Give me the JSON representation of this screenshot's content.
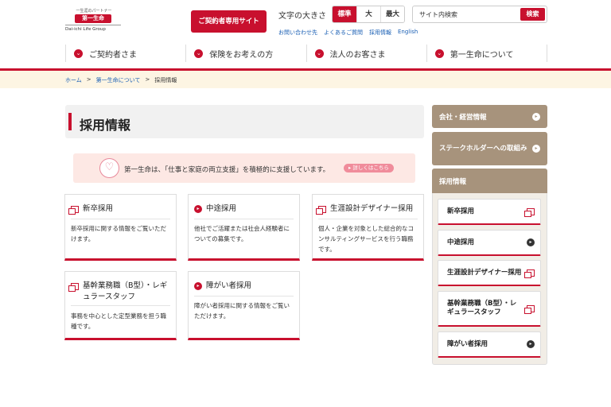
{
  "logo": {
    "tagline": "一生涯のパートナー",
    "mark": "第一生命",
    "group": "Dai-ichi Life Group"
  },
  "header": {
    "contract_button": "ご契約者専用サイト",
    "font_size_label": "文字の大きさ",
    "font_sizes": [
      "標準",
      "大",
      "最大"
    ],
    "search_placeholder": "サイト内検索",
    "search_button": "検索",
    "util_links": [
      "お問い合わせ先",
      "よくあるご質問",
      "採用情報",
      "English"
    ]
  },
  "nav": [
    "ご契約者さま",
    "保険をお考えの方",
    "法人のお客さま",
    "第一生命について"
  ],
  "breadcrumb": [
    "ホーム",
    "第一生命について",
    "採用情報"
  ],
  "page_title": "採用情報",
  "banner": {
    "text": "第一生命は、「仕事と家庭の両立支援」を積極的に支援しています。",
    "link": "▸ 詳しくはこちら"
  },
  "cards": [
    {
      "title": "新卒採用",
      "desc": "新卒採用に関する情報をご覧いただけます。",
      "icon": "external-link"
    },
    {
      "title": "中途採用",
      "desc": "他社でご活躍または社会人経験者についての募集です。",
      "icon": "arrow-circle"
    },
    {
      "title": "生涯設計デザイナー採用",
      "desc": "個人・企業を対象とした総合的なコンサルティングサービスを行う職務です。",
      "icon": "external-link"
    },
    {
      "title": "基幹業務職（B型）・レギュラースタッフ",
      "desc": "事務を中心とした定型業務を担う職種です。",
      "icon": "external-link"
    },
    {
      "title": "障がい者採用",
      "desc": "障がい者採用に関する情報をご覧いただけます。",
      "icon": "arrow-circle"
    }
  ],
  "sidebar": {
    "heads": [
      "会社・経営情報",
      "ステークホルダーへの取組み",
      "採用情報"
    ],
    "items": [
      {
        "label": "新卒採用",
        "icon": "external-link"
      },
      {
        "label": "中途採用",
        "icon": "arrow-circle"
      },
      {
        "label": "生涯設計デザイナー採用",
        "icon": "external-link"
      },
      {
        "label": "基幹業務職（B型）・レギュラースタッフ",
        "icon": "external-link"
      },
      {
        "label": "障がい者採用",
        "icon": "arrow-circle"
      }
    ]
  },
  "colors": {
    "brand_red": "#c8102e",
    "sidebar_brown": "#a7937c",
    "crumb_band": "#fdf5e3"
  }
}
